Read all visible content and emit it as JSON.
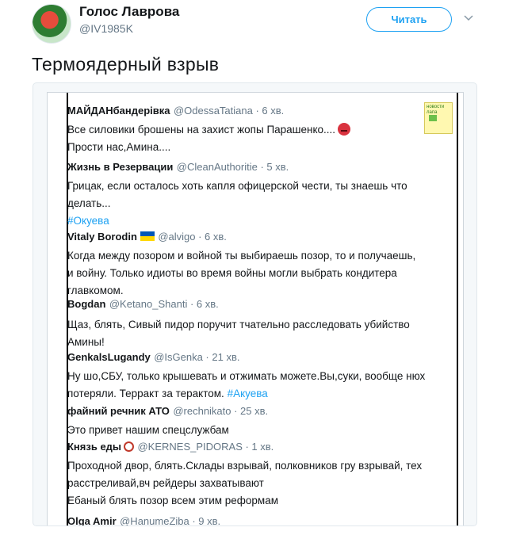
{
  "profile": {
    "display_name": "Голос Лаврова",
    "handle": "@IV1985K",
    "follow_label": "Читать"
  },
  "tweet": {
    "text": "Термоядерный взрыв"
  },
  "embedded_image": {
    "thumbnail_text": "новости лапа",
    "entries": [
      {
        "name": "МАЙДАНбандерівка",
        "meta": "@OdessaTatiana · 6 хв.",
        "lines": [
          "Все силовики брошены на захист жопы Парашенко....",
          "Прости нас,Амина...."
        ]
      },
      {
        "name": "Жизнь в Резервации",
        "meta": "@CleanAuthoritie · 5 хв.",
        "lines": [
          "Грицак, если осталось хоть капля офицерской чести, ты знаешь что",
          "делать..."
        ],
        "hashtag": "#Окуева"
      },
      {
        "name": "Vitaly Borodin",
        "meta": "@alvigo · 6 хв.",
        "lines": [
          "Когда между позором и войной ты выбираешь позор, то и получаешь,",
          "и войну. Только идиоты  во время войны могли выбрать кондитера",
          "главкомом."
        ]
      },
      {
        "name": "Bogdan",
        "meta": "@Ketano_Shanti · 6 хв.",
        "lines": [
          "Щаз, блять, Сивый пидор поручит тчательно расследовать убийство",
          "Амины!"
        ]
      },
      {
        "name": "GenkalsLugandy",
        "meta": "@IsGenka · 21 хв.",
        "lines": [
          "Ну шо,СБУ, только крышевать и отжимать можете.Вы,суки, вообще нюх",
          "потеряли. Терракт за терактом."
        ],
        "hashtag": "#Акуева"
      },
      {
        "name": "файний речник АТО",
        "meta": "@rechnikato · 25 хв.",
        "lines": [
          "Это привет нашим спецслужбам"
        ]
      },
      {
        "name": "Князь еды",
        "meta": "@KERNES_PIDORAS · 1 хв.",
        "lines": [
          "Проходной двор, блять.Склады взрывай, полковников гру взрывай, тех",
          "расстреливай,вч рейдеры захватывают",
          "Ебаный блять позор всем этим реформам"
        ]
      },
      {
        "name": "Olga Amir",
        "meta": "@HanumeZiba · 9 хв.",
        "lines": []
      }
    ]
  }
}
